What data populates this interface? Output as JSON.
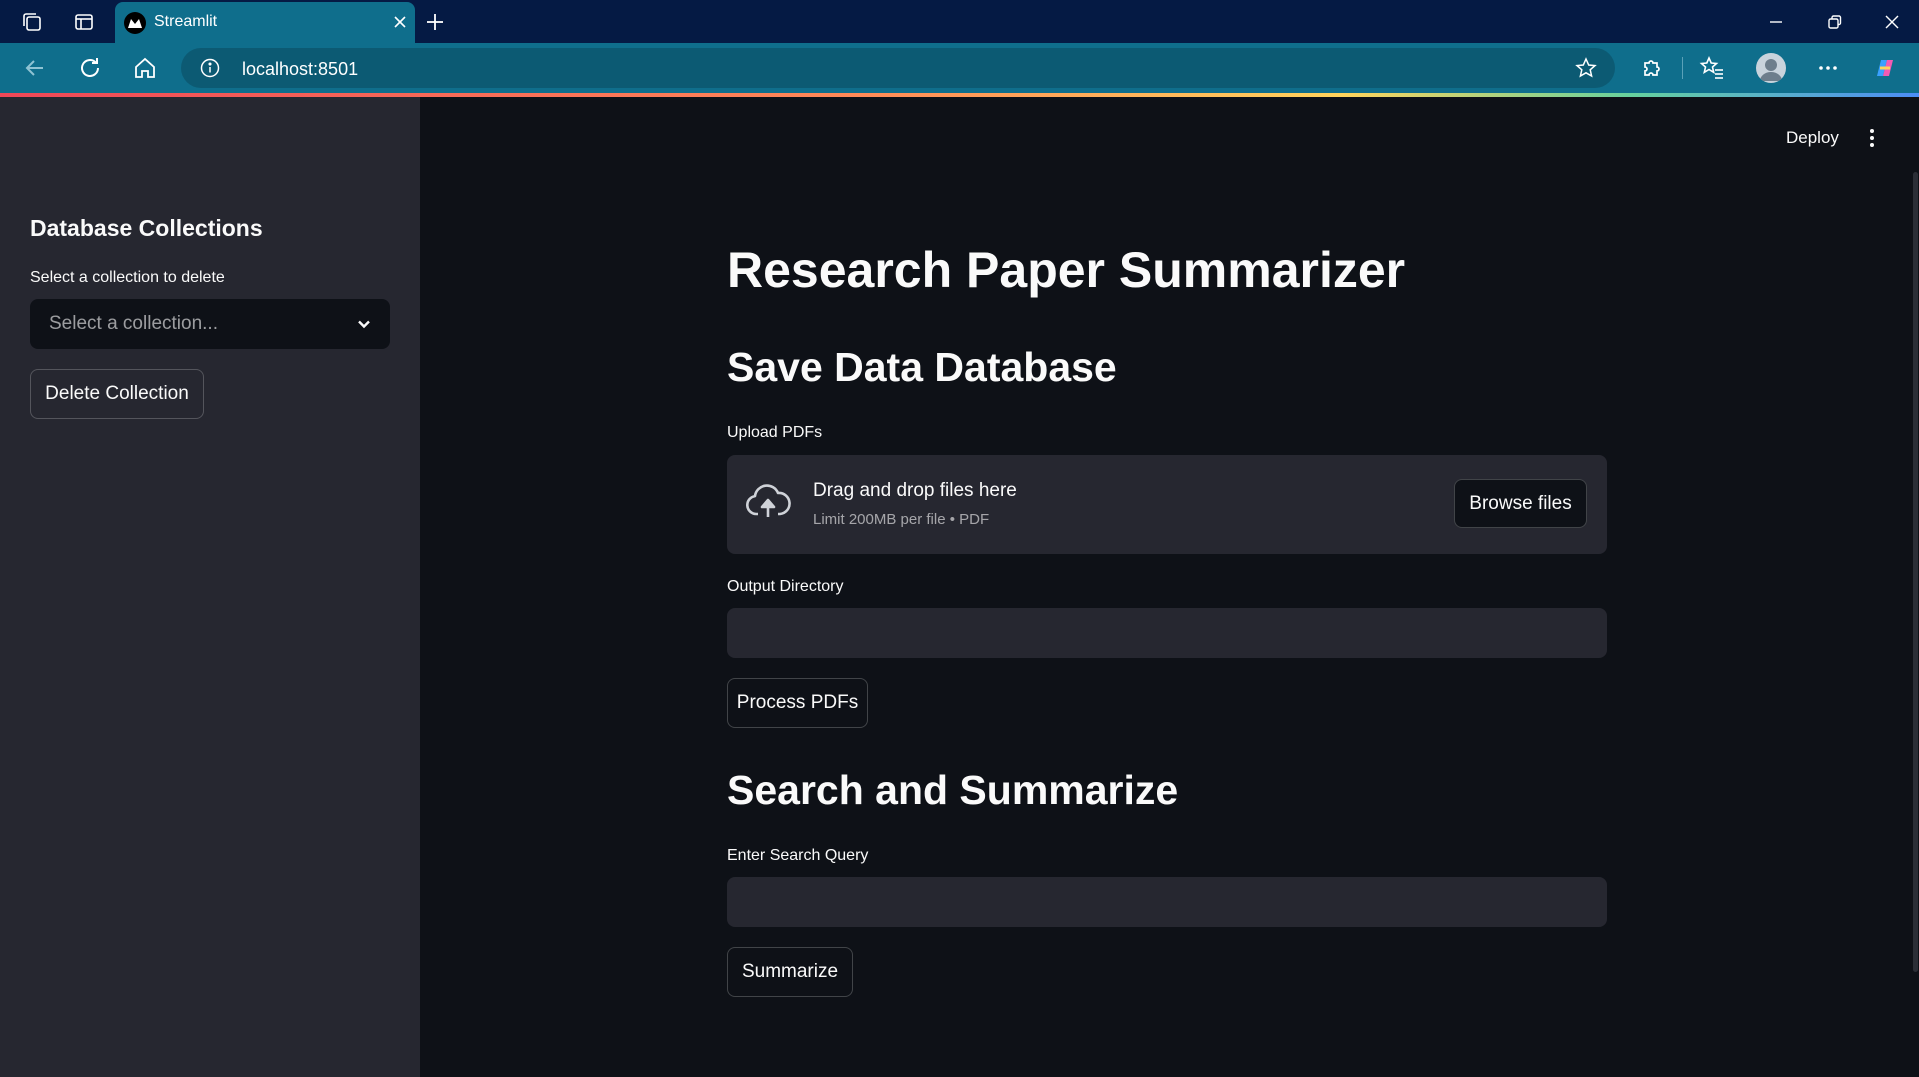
{
  "browser": {
    "tab": {
      "title": "Streamlit"
    },
    "url": "localhost:8501"
  },
  "header": {
    "deploy_label": "Deploy"
  },
  "sidebar": {
    "title": "Database Collections",
    "select_label": "Select a collection to delete",
    "select_placeholder": "Select a collection...",
    "delete_button": "Delete Collection"
  },
  "main": {
    "title": "Research Paper Summarizer",
    "save_section": {
      "heading": "Save Data Database",
      "upload_label": "Upload PDFs",
      "dropzone_title": "Drag and drop files here",
      "dropzone_subtitle": "Limit 200MB per file • PDF",
      "browse_button": "Browse files",
      "output_label": "Output Directory",
      "output_value": "",
      "process_button": "Process PDFs"
    },
    "search_section": {
      "heading": "Search and Summarize",
      "query_label": "Enter Search Query",
      "query_value": "",
      "summarize_button": "Summarize"
    }
  },
  "colors": {
    "app_background": "#0e1117",
    "sidebar_background": "#262730",
    "input_background": "#262730",
    "browser_tabbar": "#051a44",
    "browser_accent": "#0f6e8c",
    "text": "#fafafa"
  }
}
